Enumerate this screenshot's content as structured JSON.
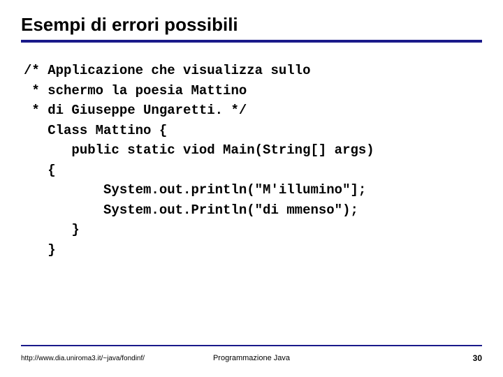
{
  "title": "Esempi di errori possibili",
  "code": {
    "l1": "/* Applicazione che visualizza sullo",
    "l2": " * schermo la poesia Mattino",
    "l3": " * di Giuseppe Ungaretti. */",
    "l4": "   Class Mattino {",
    "l5": "      public static viod Main(String[] args)",
    "l6": "   {",
    "l7": "          System.out.println(\"M'illumino\"];",
    "l8": "          System.out.Println(\"di mmenso\");",
    "l9": "      }",
    "l10": "   }"
  },
  "footer": {
    "left": "http://www.dia.uniroma3.it/~java/fondinf/",
    "center": "Programmazione Java",
    "page": "30"
  }
}
